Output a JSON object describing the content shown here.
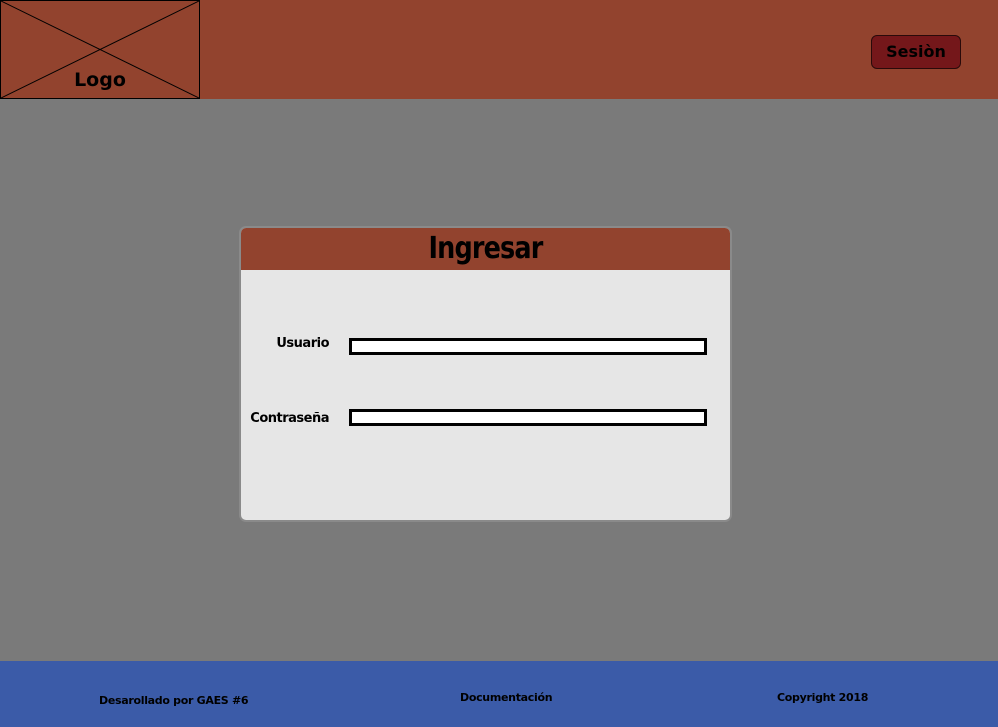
{
  "header": {
    "logo_label": "Logo",
    "session_button": "Sesiòn"
  },
  "login": {
    "title": "Ingresar",
    "user_label": "Usuario",
    "user_value": "",
    "password_label": "Contraseña",
    "password_value": ""
  },
  "footer": {
    "credit": "Desarollado por GAES #6",
    "docs_link": "Documentación",
    "copyright": "Copyright 2018"
  },
  "colors": {
    "header_bg": "#92432e",
    "page_bg": "#7a7a7a",
    "card_bg": "#e6e6e6",
    "button_bg": "#74171a",
    "footer_bg": "#3b5ba8"
  }
}
